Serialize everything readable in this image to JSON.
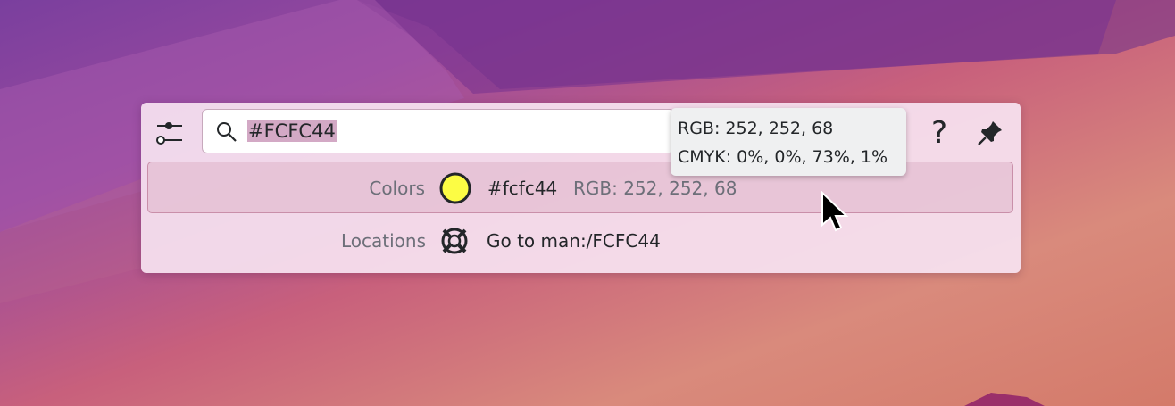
{
  "search": {
    "query": "#FCFC44"
  },
  "toolbar": {
    "help_label": "?"
  },
  "results": [
    {
      "category": "Colors",
      "icon": "color-swatch-icon",
      "swatch_color": "#fcfc44",
      "text": "#fcfc44",
      "subtext": "RGB: 252, 252, 68"
    },
    {
      "category": "Locations",
      "icon": "lifebuoy-icon",
      "text": "Go to man:/FCFC44"
    }
  ],
  "tooltip": {
    "line1": "RGB: 252, 252, 68",
    "line2": "CMYK: 0%, 0%, 73%, 1%"
  },
  "colors": {
    "selection": "#d3a9c5",
    "panel": "#f6e2f0",
    "text": "#232629",
    "muted": "#6d6f79"
  }
}
